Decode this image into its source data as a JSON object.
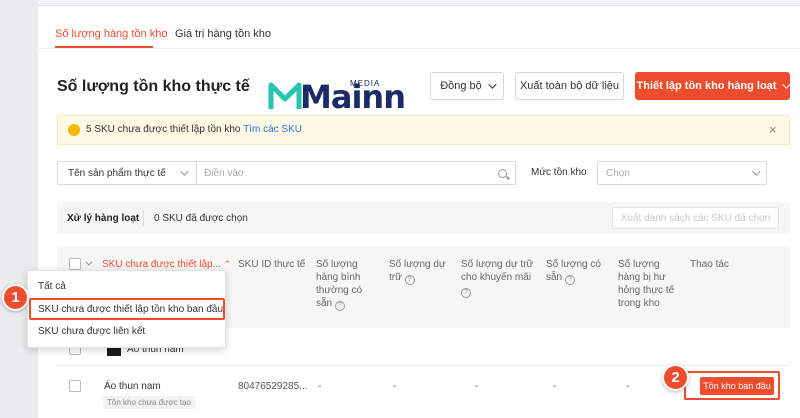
{
  "tabs": [
    {
      "label": "Số lượng hàng tồn kho",
      "active": true
    },
    {
      "label": "Giá trị hàng tồn kho",
      "active": false
    }
  ],
  "header": {
    "title": "Số lượng tồn kho thực tế",
    "sync_label": "Đồng bộ",
    "export_all_label": "Xuất toàn bộ dữ liệu",
    "bulk_setup_label": "Thiết lập tồn kho hàng loạt"
  },
  "logo": {
    "word": "Mainn",
    "sub": "MEDIA"
  },
  "alert": {
    "text": "5 SKU chưa được thiết lập tồn kho",
    "link": "Tìm các SKU",
    "close": "×"
  },
  "filter": {
    "field_select": "Tên sản phẩm thực tế",
    "input_placeholder": "Điền vào",
    "stock_label": "Mức tồn kho",
    "stock_placeholder": "Chọn"
  },
  "bulk": {
    "title": "Xử lý hàng loạt",
    "selected": "0 SKU đã được chọn",
    "export_selected": "Xuất danh sách các SKU đã chọn"
  },
  "table": {
    "columns": {
      "sku_filter": "SKU chưa được thiết lập...",
      "sku_id": "SKU ID thực tế",
      "normal_qty": [
        "Số lượng",
        "hàng bình",
        "thường có",
        "sẵn"
      ],
      "reserved": [
        "Số lượng dự",
        "trữ"
      ],
      "promo_reserved": [
        "Số lượng dự trữ",
        "cho khuyến mãi"
      ],
      "available": [
        "Số lượng có",
        "sẵn"
      ],
      "damaged": [
        "Số lượng",
        "hàng bị hư",
        "hỏng thực tế",
        "trong kho"
      ],
      "actions": "Thao tác"
    },
    "rows": [
      {
        "name": "Áo thun nam",
        "tag": "Tồn kho chưa được tạo",
        "sku_id": "80476529285...",
        "normal_qty": "-",
        "reserved": "-",
        "promo_reserved": "-",
        "available": "-",
        "damaged": "-",
        "action": "Tồn kho ban đầu"
      }
    ],
    "partial_row_name": "Áo thun nam"
  },
  "dropdown": {
    "items": [
      "Tất cả",
      "SKU chưa được thiết lập tồn kho ban đầu",
      "SKU chưa được liên kết"
    ]
  },
  "callouts": [
    "1",
    "2"
  ],
  "colors": {
    "accent": "#ee4d2d",
    "link": "#2673dd",
    "alert_bg": "#fff8e4",
    "logo_teal": "#27c4b4",
    "logo_navy": "#1a2b66"
  }
}
